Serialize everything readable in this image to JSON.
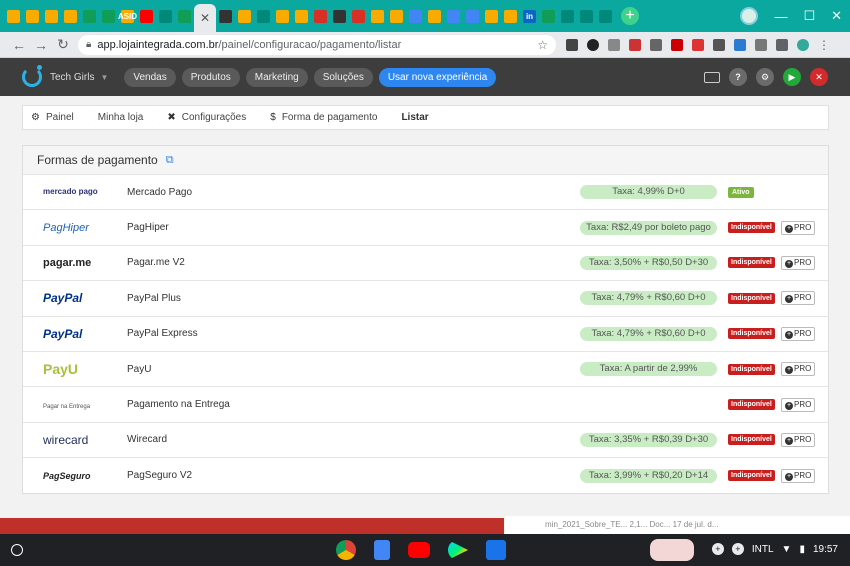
{
  "browser": {
    "url_host": "app.lojaintegrada.com.br",
    "url_path": "/painel/configuracao/pagamento/listar",
    "tabs": [
      {
        "icon": "slides-icon",
        "color": "#f9ab00"
      },
      {
        "icon": "audio-icon",
        "color": "#f9ab00"
      },
      {
        "icon": "account-icon",
        "color": "#f9ab00"
      },
      {
        "icon": "drive-icon",
        "color": "#f9ab00"
      },
      {
        "icon": "sheets-icon",
        "color": "#0f9d58"
      },
      {
        "icon": "sheets-icon",
        "color": "#0f9d58"
      },
      {
        "icon": "asid-icon",
        "color": "#f9ab00",
        "text": "ASID"
      },
      {
        "icon": "youtube-icon",
        "color": "#ff0000"
      },
      {
        "icon": "meet-icon",
        "color": "#00897b"
      },
      {
        "icon": "classroom-icon",
        "color": "#0f9d58"
      },
      {
        "icon": "active-tab",
        "color": "#e8eaed",
        "active": true
      },
      {
        "icon": "notion-icon",
        "color": "#333"
      },
      {
        "icon": "photo-icon",
        "color": "#f9ab00"
      },
      {
        "icon": "meet-icon",
        "color": "#00897b"
      },
      {
        "icon": "drive-icon",
        "color": "#f9ab00"
      },
      {
        "icon": "slides-icon",
        "color": "#f9ab00"
      },
      {
        "icon": "gmail-icon",
        "color": "#d93025"
      },
      {
        "icon": "notion-icon",
        "color": "#333"
      },
      {
        "icon": "gmail-icon",
        "color": "#d93025"
      },
      {
        "icon": "slides-icon",
        "color": "#f9ab00"
      },
      {
        "icon": "drive-icon",
        "color": "#f9ab00"
      },
      {
        "icon": "docs-icon",
        "color": "#4285f4"
      },
      {
        "icon": "drive-icon",
        "color": "#f9ab00"
      },
      {
        "icon": "docs-icon",
        "color": "#4285f4"
      },
      {
        "icon": "docs-icon",
        "color": "#4285f4"
      },
      {
        "icon": "slides-icon",
        "color": "#f9ab00"
      },
      {
        "icon": "slides-icon",
        "color": "#f9ab00"
      },
      {
        "icon": "linkedin-icon",
        "color": "#0a66c2",
        "text": "in"
      },
      {
        "icon": "chart-icon",
        "color": "#0f9d58"
      },
      {
        "icon": "star-icon",
        "color": "#00897b"
      },
      {
        "icon": "meet-icon",
        "color": "#00897b"
      },
      {
        "icon": "meet-icon",
        "color": "#00897b"
      }
    ]
  },
  "app": {
    "store_name": "Tech Girls",
    "menu": [
      "Vendas",
      "Produtos",
      "Marketing",
      "Soluções"
    ],
    "new_experience": "Usar nova experiência"
  },
  "breadcrumb": {
    "items": [
      {
        "label": "Painel",
        "icon": "gear-icon",
        "glyph": "⚙"
      },
      {
        "label": "Minha loja",
        "icon": "",
        "glyph": ""
      },
      {
        "label": "Configurações",
        "icon": "wrench-icon",
        "glyph": "✖"
      },
      {
        "label": "Forma de pagamento",
        "icon": "dollar-icon",
        "glyph": "$"
      },
      {
        "label": "Listar",
        "icon": "",
        "glyph": ""
      }
    ]
  },
  "panel": {
    "title": "Formas de pagamento",
    "methods": [
      {
        "logo_text": "mercado pago",
        "logo_class": "lg-mercado",
        "name": "Mercado Pago",
        "tax": "Taxa: 4,99% D+0",
        "status": "Ativo",
        "active": true
      },
      {
        "logo_text": "PagHiper",
        "logo_class": "lg-paghiper",
        "name": "PagHiper",
        "tax": "Taxa: R$2,49 por boleto pago",
        "status": "Indisponível",
        "pro": "PRO"
      },
      {
        "logo_text": "pagar.me",
        "logo_class": "lg-pagarme",
        "name": "Pagar.me V2",
        "tax": "Taxa: 3,50% + R$0,50 D+30",
        "status": "Indisponível",
        "pro": "PRO"
      },
      {
        "logo_text": "PayPal",
        "logo_class": "lg-paypal",
        "name": "PayPal Plus",
        "tax": "Taxa: 4,79% + R$0,60 D+0",
        "status": "Indisponível",
        "pro": "PRO"
      },
      {
        "logo_text": "PayPal",
        "logo_class": "lg-paypal",
        "name": "PayPal Express",
        "tax": "Taxa: 4,79% + R$0,60 D+0",
        "status": "Indisponível",
        "pro": "PRO"
      },
      {
        "logo_text": "PayU",
        "logo_class": "lg-payu",
        "name": "PayU",
        "tax": "Taxa: A partir de 2,99%",
        "status": "Indisponível",
        "pro": "PRO"
      },
      {
        "logo_text": "Pagar na Entrega",
        "logo_class": "lg-entrega",
        "name": "Pagamento na Entrega",
        "tax": "",
        "status": "Indisponível",
        "pro": "PRO"
      },
      {
        "logo_text": "wirecard",
        "logo_class": "lg-wirecard",
        "name": "Wirecard",
        "tax": "Taxa: 3,35% + R$0,39 D+30",
        "status": "Indisponível",
        "pro": "PRO"
      },
      {
        "logo_text": "PagSeguro",
        "logo_class": "lg-pagseguro",
        "name": "PagSeguro V2",
        "tax": "Taxa: 3,99% + R$0,20 D+14",
        "status": "Indisponível",
        "pro": "PRO"
      }
    ]
  },
  "peek": {
    "file_text": "min_2021_Sobre_TE...   2,1...   Doc...   17 de jul. d..."
  },
  "shelf": {
    "locale": "INTL",
    "time": "19:57"
  }
}
